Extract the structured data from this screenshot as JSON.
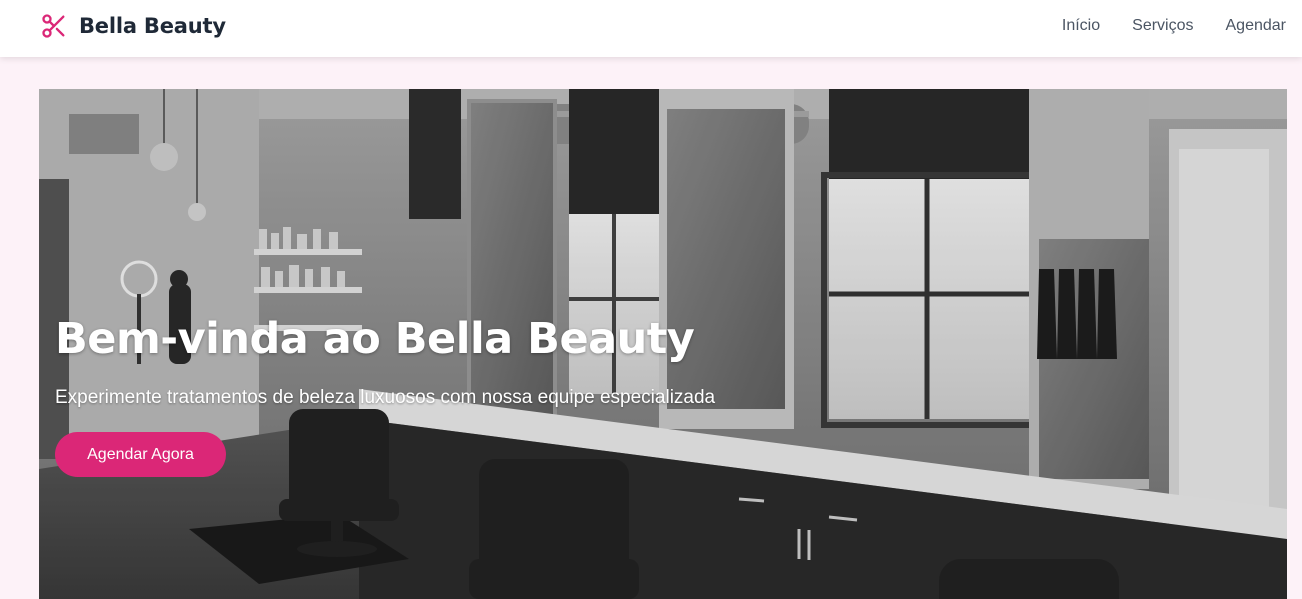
{
  "brand": {
    "name": "Bella Beauty",
    "icon": "scissors-icon",
    "accent_color": "#db2777"
  },
  "nav": {
    "items": [
      {
        "label": "Início"
      },
      {
        "label": "Serviços"
      },
      {
        "label": "Agendar"
      }
    ]
  },
  "hero": {
    "title": "Bem-vinda ao Bella Beauty",
    "subtitle": "Experimente tratamentos de beleza luxuosos com nossa equipe especializada",
    "cta_label": "Agendar Agora",
    "background": "salon-interior-photo"
  },
  "colors": {
    "page_background": "#fdf2f8",
    "header_background": "#ffffff",
    "brand_text": "#1f2937",
    "nav_text": "#4b5563",
    "button_background": "#db2777",
    "button_text": "#ffffff"
  }
}
